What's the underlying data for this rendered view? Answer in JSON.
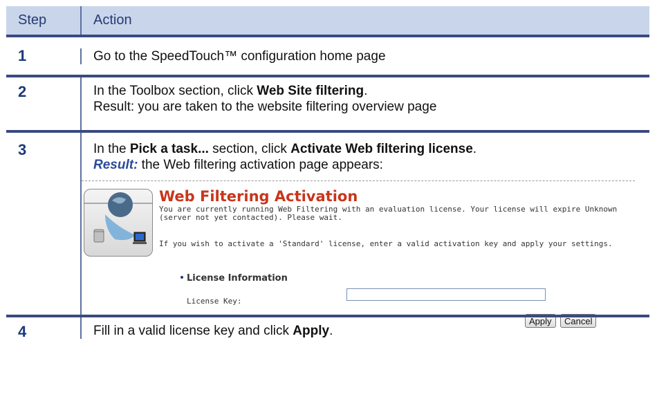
{
  "header": {
    "step": "Step",
    "action": "Action"
  },
  "rows": [
    {
      "step": "1",
      "parts": [
        {
          "text": "Go to the SpeedTouch™ configuration home page"
        }
      ]
    },
    {
      "step": "2",
      "line1": {
        "pre": "In the Toolbox section, click ",
        "bold": "Web Site filtering",
        "post": "."
      },
      "line2": "Result: you are taken to the website filtering overview page"
    },
    {
      "step": "3",
      "line1": {
        "pre": "In the ",
        "bold1": "Pick a task...",
        "mid": " section, click ",
        "bold2": "Activate Web filtering license",
        "post": "."
      },
      "line2": {
        "label": "Result:",
        "text": " the Web filtering activation page appears:"
      }
    },
    {
      "step": "4",
      "line1": {
        "pre": "Fill in a valid license key and click ",
        "bold": "Apply",
        "post": "."
      }
    }
  ],
  "screenshot": {
    "title": "Web Filtering Activation",
    "description": "You are currently running Web Filtering with an evaluation license. Your license will expire Unknown (server not yet contacted). Please wait.",
    "note": "If you wish to activate a 'Standard' license, enter a valid activation key and apply your settings.",
    "section": "License Information",
    "license_key_label": "License Key:",
    "license_key_value": "",
    "apply_label": "Apply",
    "cancel_label": "Cancel"
  },
  "colors": {
    "header_bg": "#c9d5ea",
    "step_text": "#1b3a7c",
    "title_red": "#c8361b"
  }
}
